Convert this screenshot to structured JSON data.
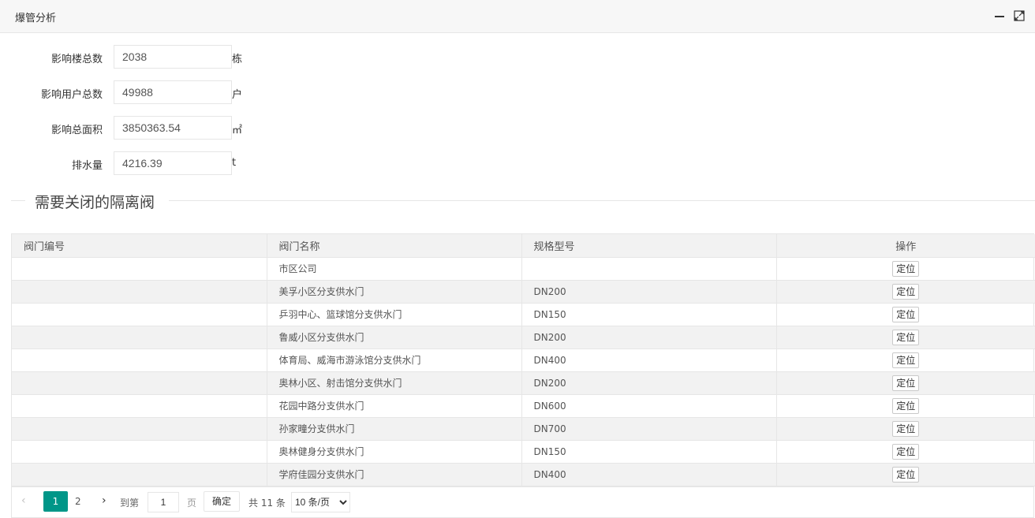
{
  "window": {
    "title": "爆管分析",
    "minimize_icon": "minus-icon",
    "maximize_icon": "expand-icon"
  },
  "stats": [
    {
      "label": "影响楼总数",
      "value": "2038",
      "unit": "栋"
    },
    {
      "label": "影响用户总数",
      "value": "49988",
      "unit": "户"
    },
    {
      "label": "影响总面积",
      "value": "3850363.54",
      "unit": "㎡"
    },
    {
      "label": "排水量",
      "value": "4216.39",
      "unit": "t"
    }
  ],
  "valve_section": {
    "legend": "需要关闭的隔离阀"
  },
  "table": {
    "headers": {
      "code": "阀门编号",
      "name": "阀门名称",
      "spec": "规格型号",
      "op": "操作"
    },
    "rows": [
      {
        "code": "",
        "name": "市区公司",
        "spec": "",
        "action": "定位"
      },
      {
        "code": "",
        "name": "美孚小区分支供水门",
        "spec": "DN200",
        "action": "定位"
      },
      {
        "code": "",
        "name": "乒羽中心、篮球馆分支供水门",
        "spec": "DN150",
        "action": "定位"
      },
      {
        "code": "",
        "name": "鲁威小区分支供水门",
        "spec": "DN200",
        "action": "定位"
      },
      {
        "code": "",
        "name": "体育局、威海市游泳馆分支供水门",
        "spec": "DN400",
        "action": "定位"
      },
      {
        "code": "",
        "name": "奥林小区、射击馆分支供水门",
        "spec": "DN200",
        "action": "定位"
      },
      {
        "code": "",
        "name": "花园中路分支供水门",
        "spec": "DN600",
        "action": "定位"
      },
      {
        "code": "",
        "name": "孙家疃分支供水门",
        "spec": "DN700",
        "action": "定位"
      },
      {
        "code": "",
        "name": "奥林健身分支供水门",
        "spec": "DN150",
        "action": "定位"
      },
      {
        "code": "",
        "name": "学府佳园分支供水门",
        "spec": "DN400",
        "action": "定位"
      }
    ]
  },
  "pager": {
    "prev": "‹",
    "current_page": "1",
    "page_2": "2",
    "next": "›",
    "goto_label": "到第",
    "goto_value": "1",
    "page_unit": "页",
    "confirm": "确定",
    "total": "共 11 条",
    "page_size": "10 条/页",
    "accent_color": "#009688"
  }
}
